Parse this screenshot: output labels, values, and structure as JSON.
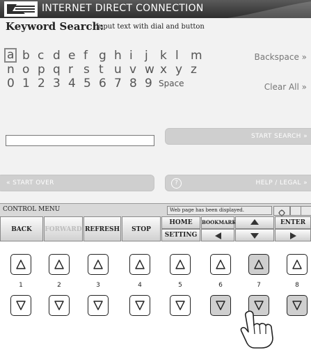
{
  "titlebar": {
    "title": "INTERNET DIRECT CONNECTION"
  },
  "keyword": {
    "heading": "Keyword Search:",
    "subheading": "Input text with dial and button",
    "rows": [
      [
        "a",
        "b",
        "c",
        "d",
        "e",
        "f",
        "g",
        "h",
        "i",
        "j",
        "k",
        "l",
        "m"
      ],
      [
        "n",
        "o",
        "p",
        "q",
        "r",
        "s",
        "t",
        "u",
        "v",
        "w",
        "x",
        "y",
        "z"
      ],
      [
        "0",
        "1",
        "2",
        "3",
        "4",
        "5",
        "6",
        "7",
        "8",
        "9"
      ]
    ],
    "space_label": "Space",
    "backspace_label": "Backspace »",
    "clear_all_label": "Clear All »",
    "input_value": "",
    "selected_char": "a"
  },
  "buttons": {
    "start_search": "Start Search »",
    "start_over": "« Start Over",
    "help_legal": "Help / Legal »",
    "help_icon": "?"
  },
  "control_menu": {
    "title": "CONTROL MENU",
    "status": "Web page has been displayed.",
    "back": "BACK",
    "forward": "FORWARD",
    "refresh": "REFRESH",
    "stop": "STOP",
    "home": "HOME",
    "setting": "SETTING",
    "bookmark": "BOOKMARK",
    "enter": "ENTER"
  },
  "hardware_buttons": {
    "numbers": [
      "1",
      "2",
      "3",
      "4",
      "5",
      "6",
      "7",
      "8"
    ],
    "pressed_up": [
      7
    ],
    "pressed_down": [
      6,
      7,
      8
    ]
  },
  "colors": {
    "titlebar": "#3a3a3a",
    "pill": "#cfcfcf",
    "screen_bg": "#f2f2f2"
  }
}
